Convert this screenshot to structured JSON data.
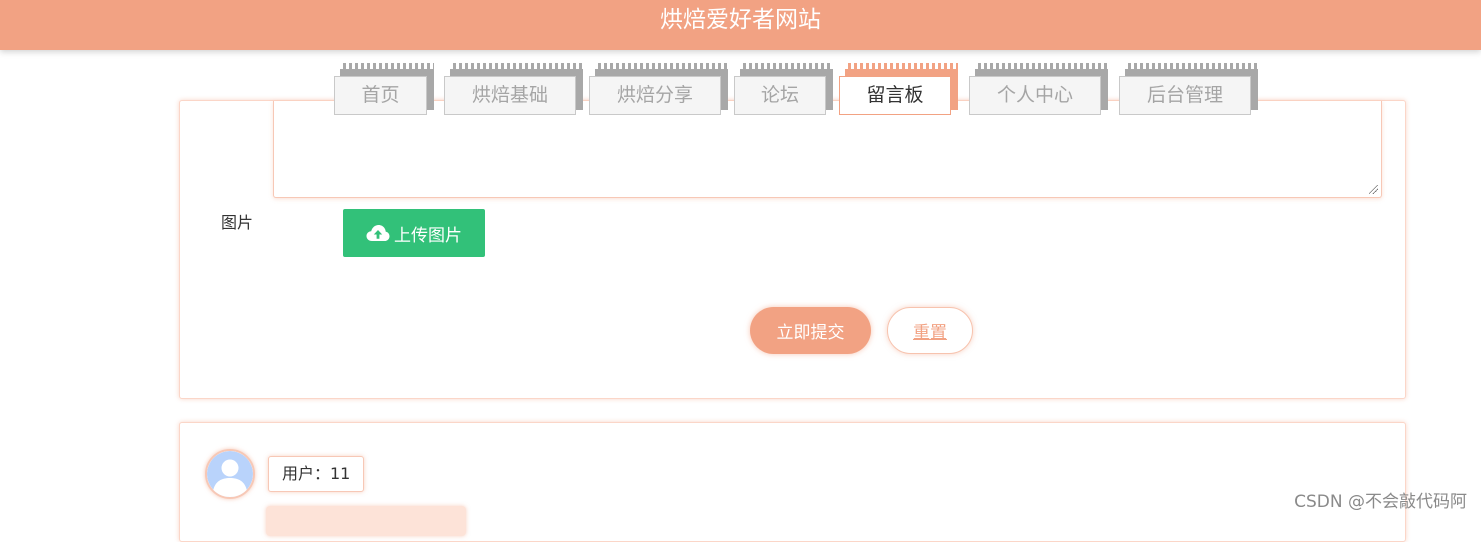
{
  "header": {
    "title": "烘焙爱好者网站"
  },
  "nav": {
    "tabs": [
      {
        "label": "首页",
        "active": false
      },
      {
        "label": "烘焙基础",
        "active": false
      },
      {
        "label": "烘焙分享",
        "active": false
      },
      {
        "label": "论坛",
        "active": false
      },
      {
        "label": "留言板",
        "active": true
      },
      {
        "label": "个人中心",
        "active": false
      },
      {
        "label": "后台管理",
        "active": false
      }
    ]
  },
  "form": {
    "content_value": "",
    "image_label": "图片",
    "upload_button": "上传图片",
    "submit_button": "立即提交",
    "reset_button": "重置"
  },
  "messages": [
    {
      "user_label": "用户：11"
    }
  ],
  "watermark": "CSDN @不会敲代码阿",
  "colors": {
    "brand": "#f2a283",
    "upload_green": "#32c179",
    "avatar_blue": "#b9d3fb"
  }
}
